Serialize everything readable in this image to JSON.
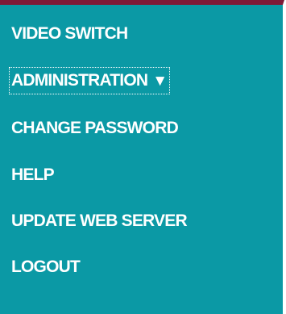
{
  "menu": {
    "items": [
      {
        "label": "VIDEO SWITCH"
      },
      {
        "label": "ADMINISTRATION",
        "suffix": "▼",
        "focused": true
      },
      {
        "label": "CHANGE PASSWORD"
      },
      {
        "label": "HELP"
      },
      {
        "label": "UPDATE WEB SERVER"
      },
      {
        "label": "LOGOUT"
      }
    ]
  },
  "colors": {
    "panel_background": "#0b99a5",
    "top_border": "#7f1a37",
    "text": "#ffffff"
  }
}
